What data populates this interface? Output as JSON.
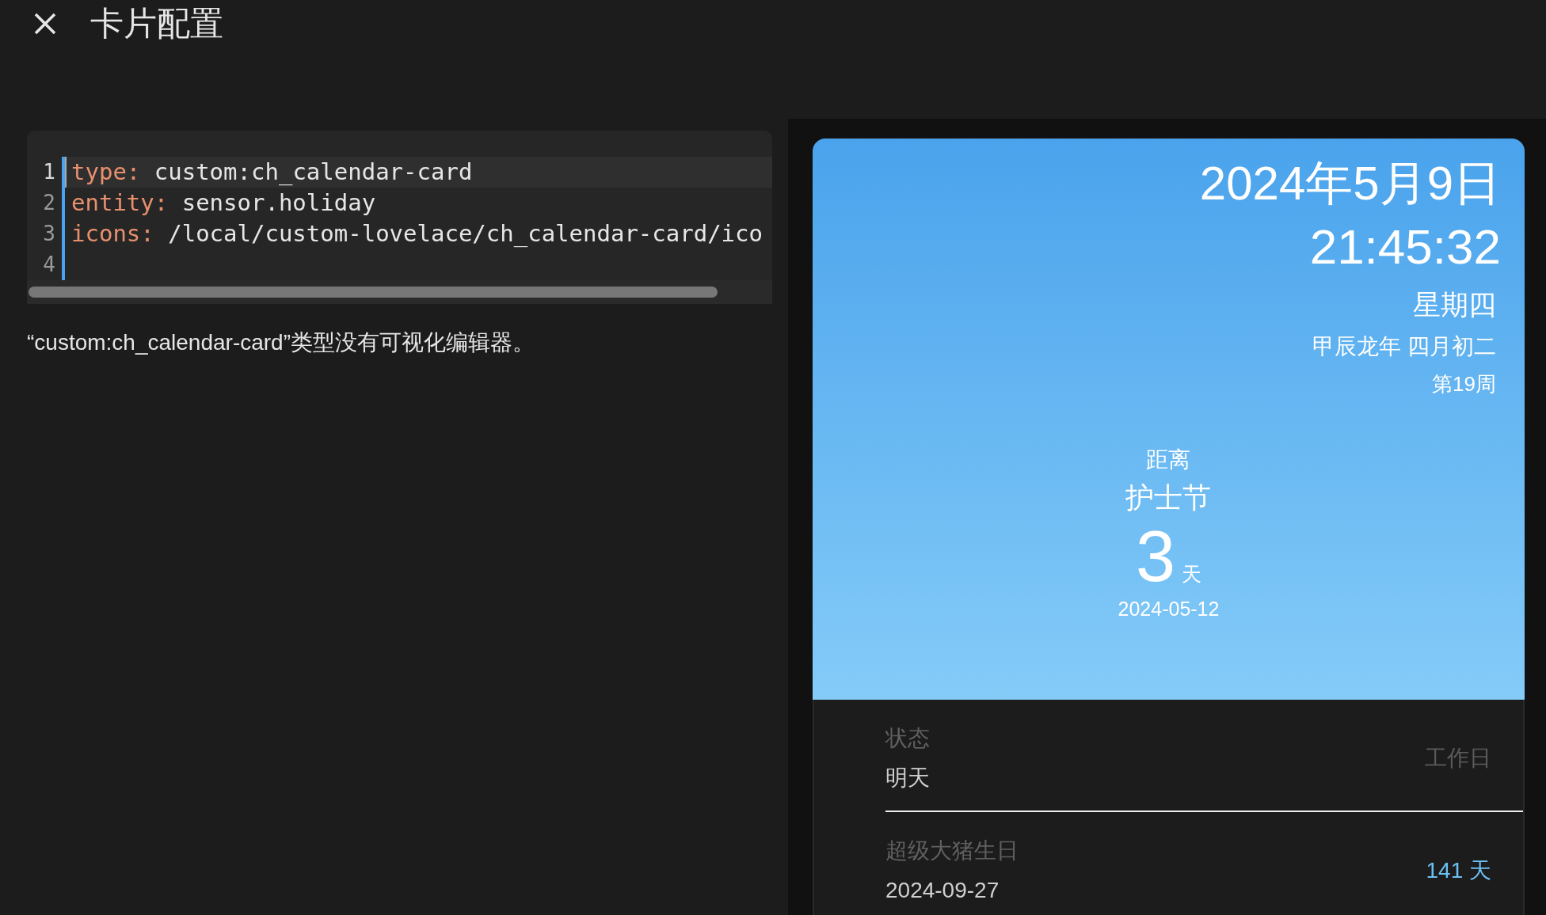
{
  "header": {
    "title": "卡片配置"
  },
  "editor": {
    "lines": [
      {
        "number": "1",
        "key": "type:",
        "value": "custom:ch_calendar-card",
        "active": true
      },
      {
        "number": "2",
        "key": "entity:",
        "value": "sensor.holiday",
        "active": false
      },
      {
        "number": "3",
        "key": "icons:",
        "value": "/local/custom-lovelace/ch_calendar-card/ico",
        "active": false
      },
      {
        "number": "4",
        "active": false
      }
    ]
  },
  "message": "“custom:ch_calendar-card”类型没有可视化编辑器。",
  "card": {
    "date": "2024年5月9日",
    "time": "21:45:32",
    "weekday": "星期四",
    "lunar": "甲辰龙年 四月初二",
    "week": "第19周",
    "countdown": {
      "label": "距离",
      "event": "护士节",
      "days": "3",
      "unit": "天",
      "date": "2024-05-12"
    },
    "list": [
      {
        "kind": "status",
        "label": "状态",
        "value": "明天",
        "right": "工作日"
      },
      {
        "kind": "countdown",
        "label": "超级大猪生日",
        "value": "2024-09-27",
        "right": "141 天"
      }
    ]
  }
}
